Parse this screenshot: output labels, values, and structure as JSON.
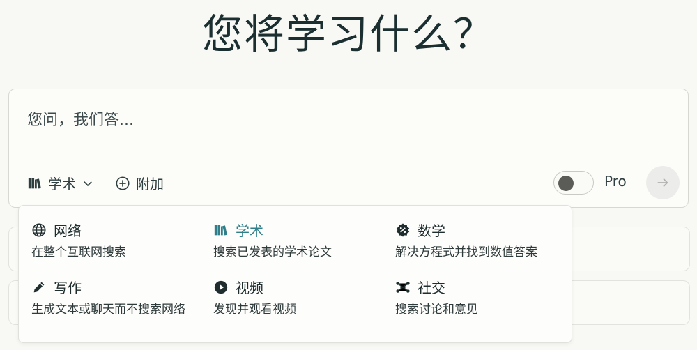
{
  "title": "您将学习什么？",
  "search": {
    "placeholder": "您问，我们答...",
    "focus_label": "学术",
    "attach_label": "附加",
    "pro_label": "Pro",
    "pro_enabled": false
  },
  "focus_menu": {
    "items": [
      {
        "label": "网络",
        "desc": "在整个互联网搜索",
        "icon": "globe-icon"
      },
      {
        "label": "学术",
        "desc": "搜索已发表的学术论文",
        "icon": "books-icon",
        "selected": true
      },
      {
        "label": "数学",
        "desc": "解决方程式并找到数值答案",
        "icon": "percent-badge-icon"
      },
      {
        "label": "写作",
        "desc": "生成文本或聊天而不搜索网络",
        "icon": "pencil-icon"
      },
      {
        "label": "视频",
        "desc": "发现并观看视频",
        "icon": "play-circle-icon"
      },
      {
        "label": "社交",
        "desc": "搜索讨论和意见",
        "icon": "network-icon"
      }
    ]
  },
  "colors": {
    "background": "#f8f8f4",
    "accent": "#2f7f8a",
    "text": "#1f2d2e"
  }
}
